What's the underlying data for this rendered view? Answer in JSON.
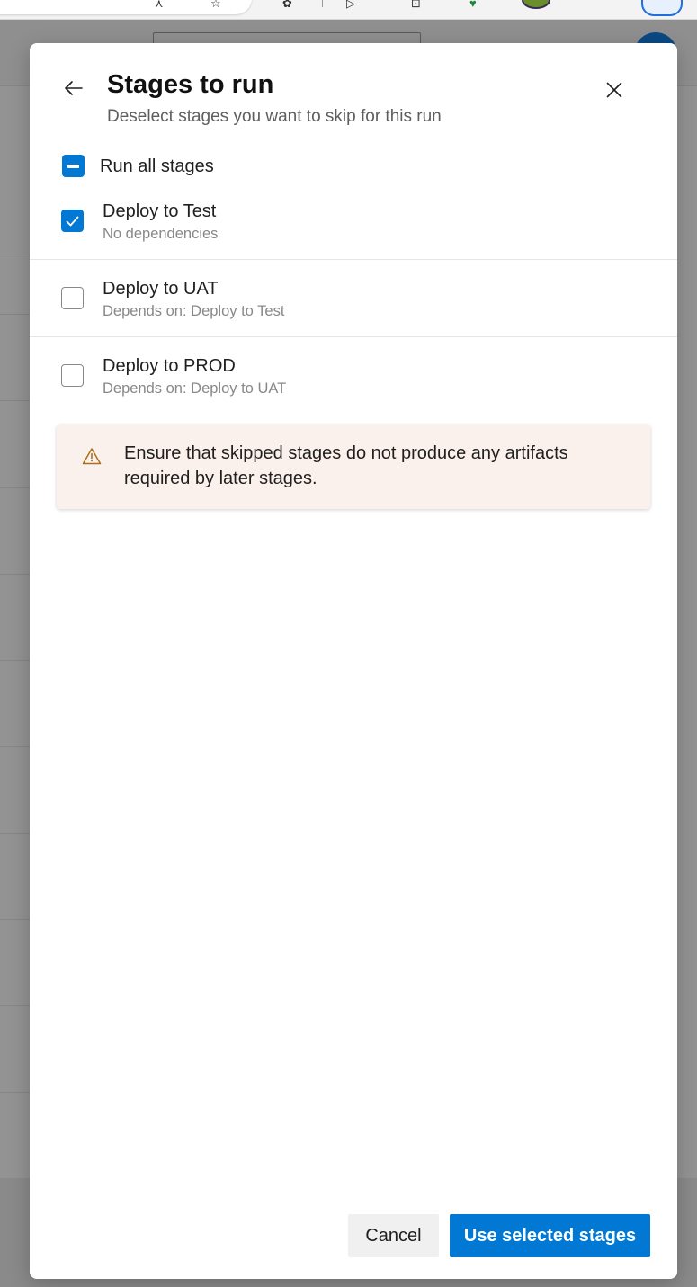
{
  "dialog": {
    "title": "Stages to run",
    "subtitle": "Deselect stages you want to skip for this run",
    "run_all": {
      "label": "Run all stages",
      "state": "mixed"
    },
    "stages": [
      {
        "name": "Deploy to Test",
        "dependency": "No dependencies",
        "checked": true
      },
      {
        "name": "Deploy to UAT",
        "dependency": "Depends on: Deploy to Test",
        "checked": false
      },
      {
        "name": "Deploy to PROD",
        "dependency": "Depends on: Deploy to UAT",
        "checked": false
      }
    ],
    "warning": {
      "icon": "warning-triangle-icon",
      "text": "Ensure that skipped stages do not produce any artifacts required by later stages."
    },
    "buttons": {
      "cancel_label": "Cancel",
      "confirm_label": "Use selected stages"
    }
  },
  "colors": {
    "accent": "#0078d4",
    "warning_bg": "#fbf1ec",
    "warning_icon": "#a8701a",
    "overlay": "#8c8c8c"
  }
}
